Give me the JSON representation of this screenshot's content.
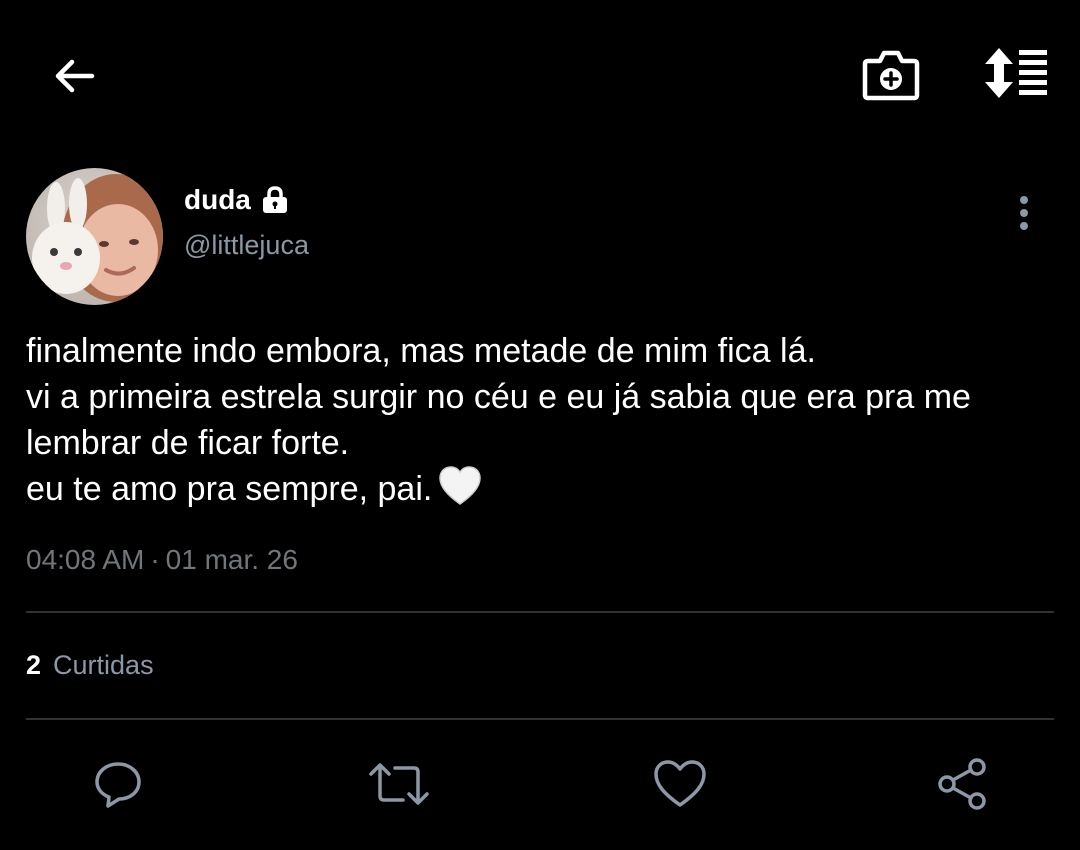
{
  "toolbar": {
    "back_icon": "arrow-left-icon",
    "camera_icon": "camera-plus-icon",
    "sort_icon": "sort-list-icon"
  },
  "tweet": {
    "author": {
      "display_name": "duda",
      "handle": "@littlejuca",
      "protected_icon": "lock-icon"
    },
    "text_lines": [
      "finalmente indo embora, mas metade de mim fica lá.",
      "vi a primeira estrela surgir no céu e eu já sabia que era pra me",
      "lembrar de ficar forte.",
      "eu te amo pra sempre, pai."
    ],
    "emoji": "white-heart-emoji",
    "time": "04:08 AM",
    "separator": "·",
    "date": "01 mar. 26",
    "likes_count": "2",
    "likes_label": "Curtidas"
  },
  "actions": {
    "reply_icon": "reply-bubble-icon",
    "retweet_icon": "retweet-icon",
    "like_icon": "heart-outline-icon",
    "share_icon": "share-icon"
  },
  "colors": {
    "background": "#000000",
    "primary_text": "#ffffff",
    "secondary_text": "#8b98a5",
    "divider": "#2f3336"
  }
}
